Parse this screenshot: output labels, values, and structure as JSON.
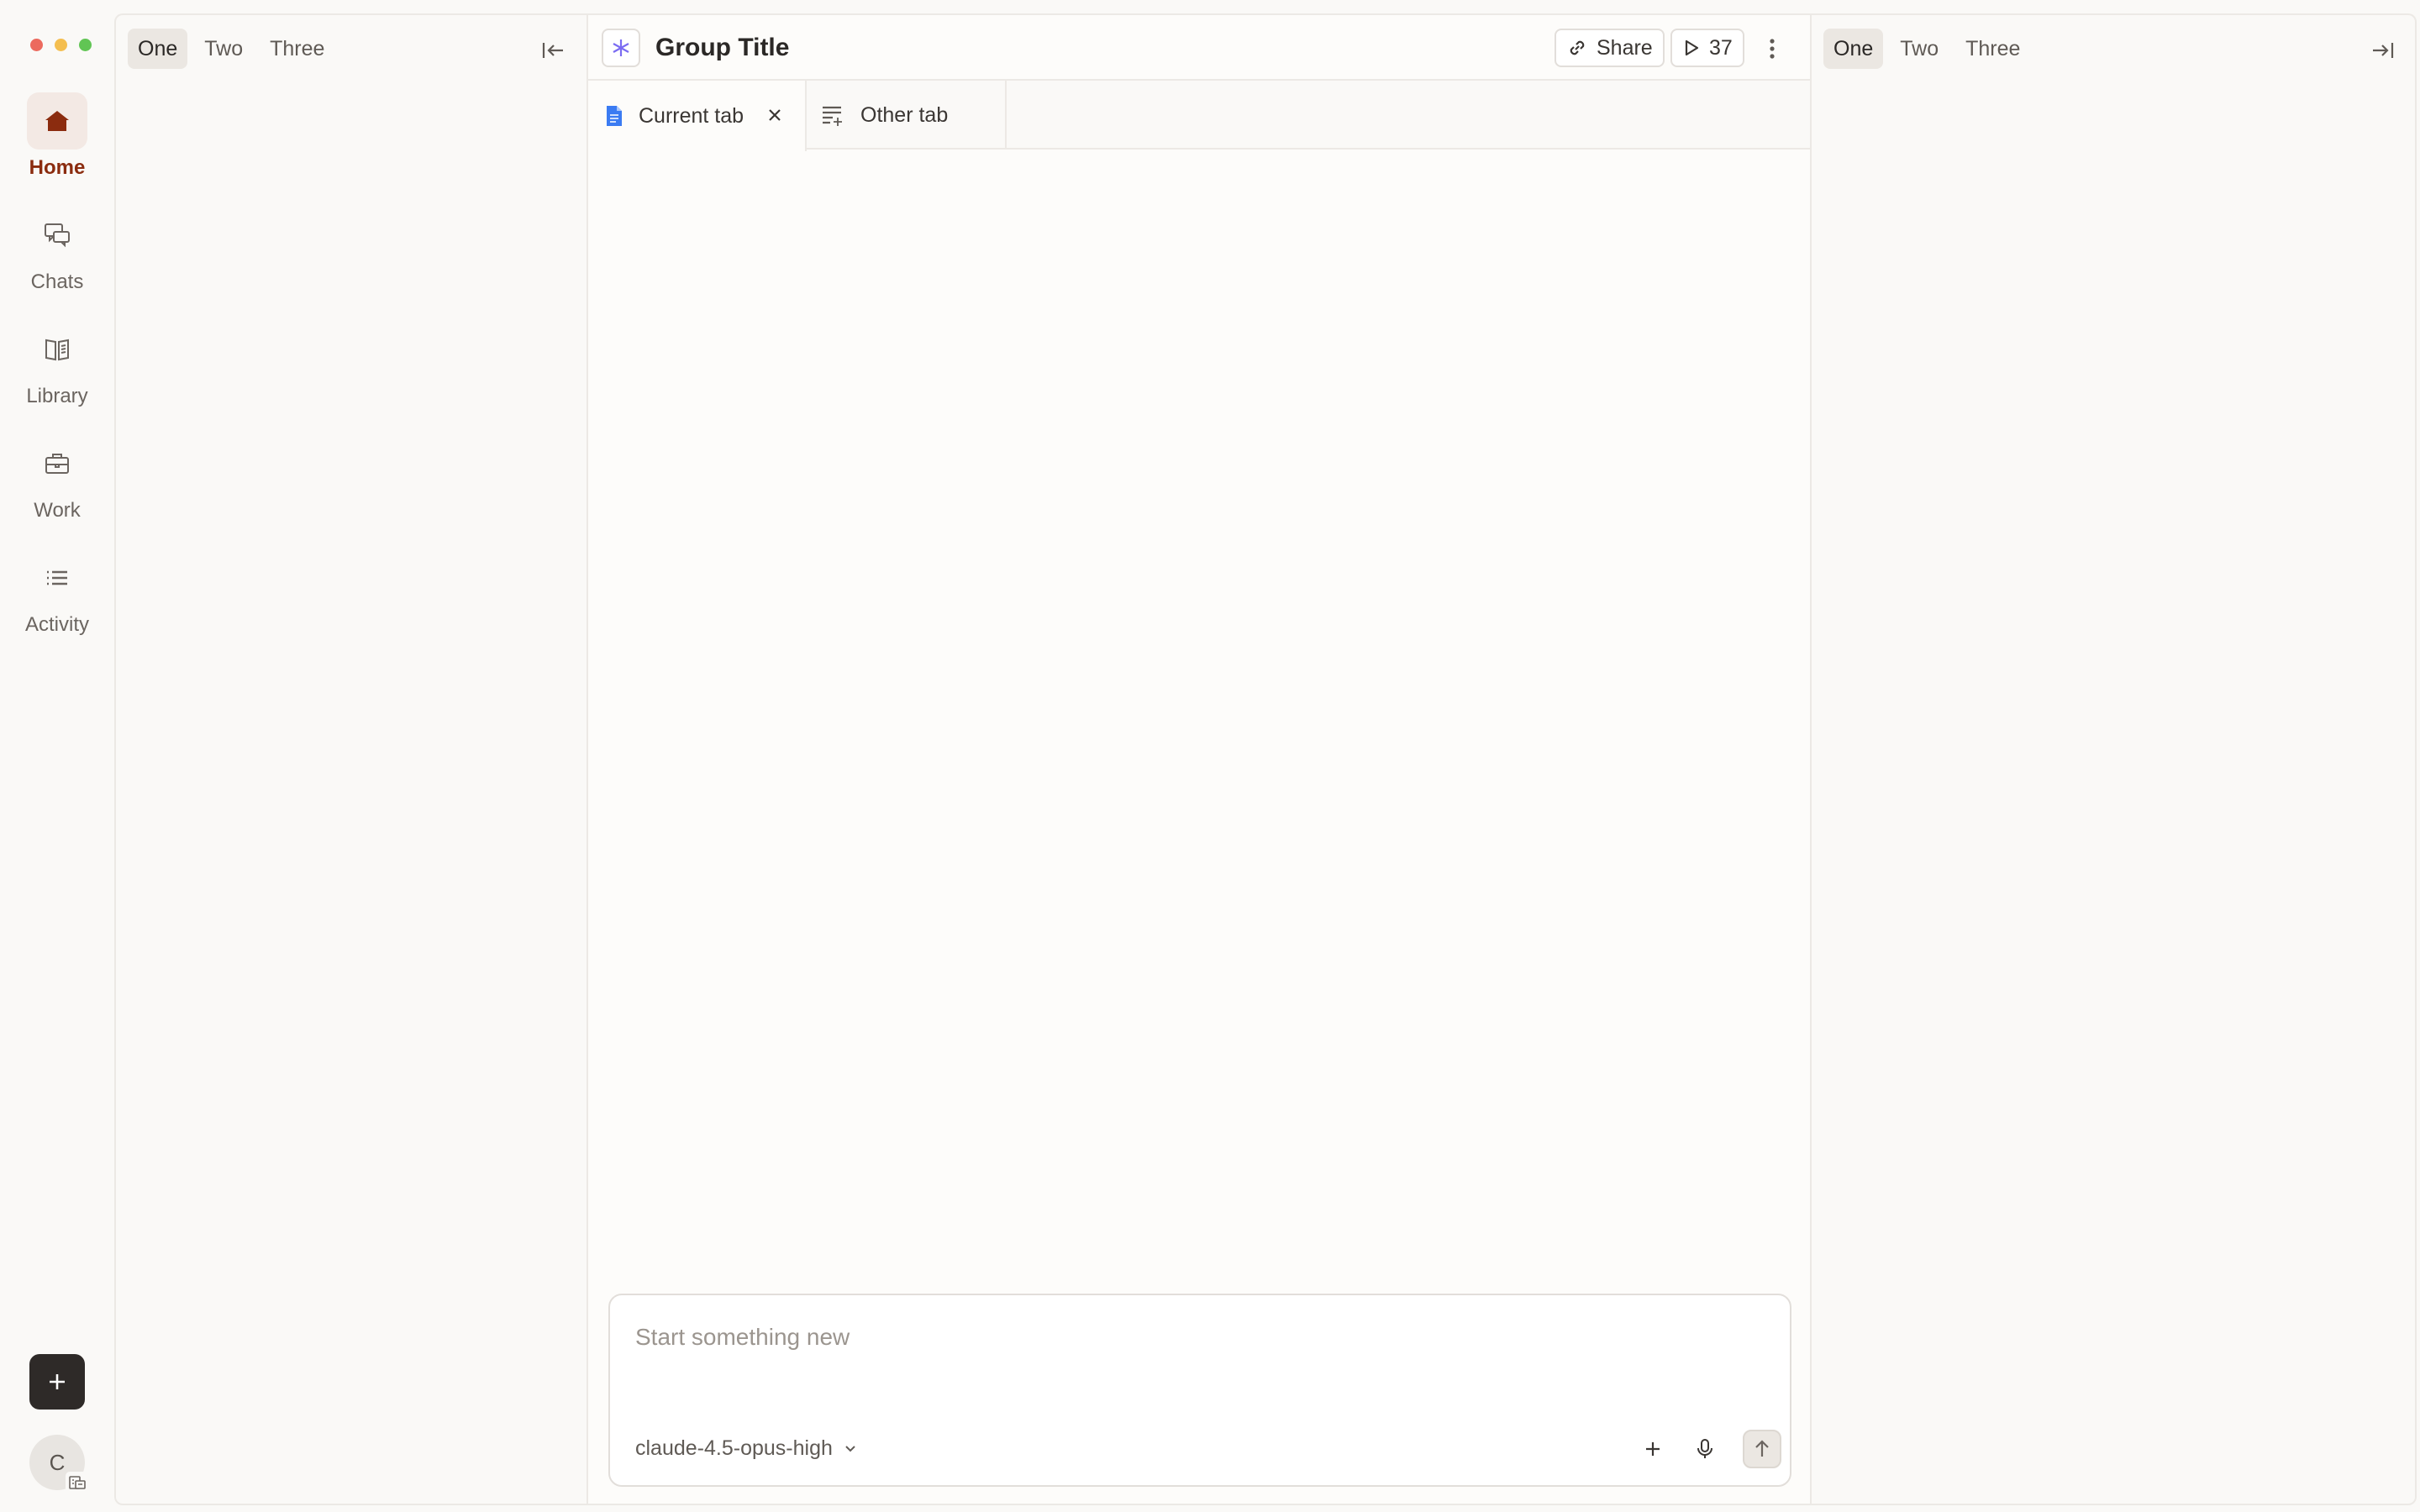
{
  "rail": {
    "nav": [
      {
        "label": "Home",
        "icon": "home-icon",
        "active": true
      },
      {
        "label": "Chats",
        "icon": "chats-icon",
        "active": false
      },
      {
        "label": "Library",
        "icon": "library-icon",
        "active": false
      },
      {
        "label": "Work",
        "icon": "briefcase-icon",
        "active": false
      },
      {
        "label": "Activity",
        "icon": "list-icon",
        "active": false
      }
    ],
    "avatar_initial": "C"
  },
  "left_panel": {
    "tabs": [
      "One",
      "Two",
      "Three"
    ],
    "active_tab": "One"
  },
  "center": {
    "group_title": "Group Title",
    "share_label": "Share",
    "run_count": "37",
    "doc_tabs": [
      {
        "label": "Current tab",
        "icon": "document-icon",
        "active": true
      },
      {
        "label": "Other tab",
        "icon": "notes-icon",
        "active": false
      }
    ],
    "composer": {
      "placeholder": "Start something new",
      "model": "claude-4.5-opus-high"
    }
  },
  "right_panel": {
    "tabs": [
      "One",
      "Two",
      "Three"
    ],
    "active_tab": "One"
  },
  "colors": {
    "accent": "#8b2c0f",
    "active_nav_bg": "#f3e9e4",
    "doc_icon_blue": "#3b7bf2",
    "group_icon_purple": "#7b6cf2"
  }
}
